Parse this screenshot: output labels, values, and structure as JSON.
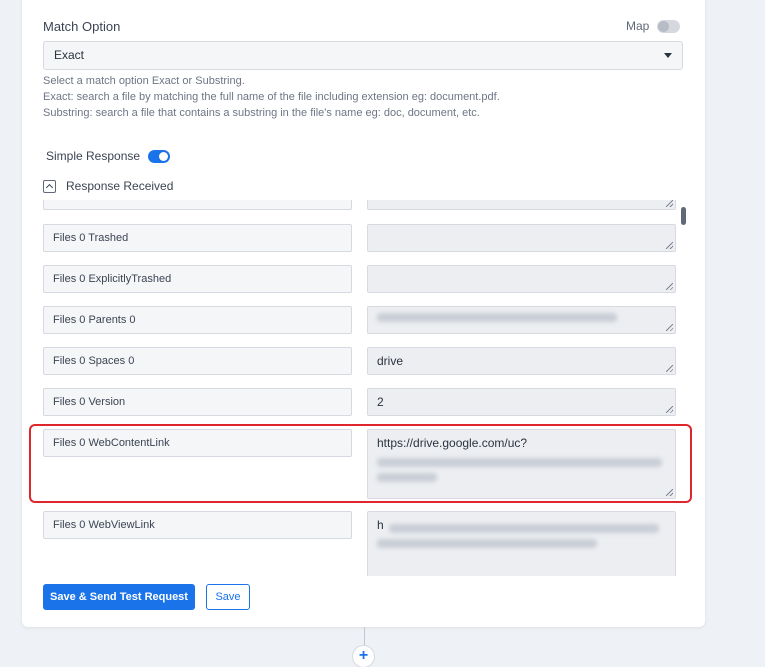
{
  "match": {
    "label": "Match Option",
    "map_label": "Map",
    "selected": "Exact",
    "help_lines": [
      "Select a match option Exact or Substring.",
      "Exact: search a file by matching the full name of the file including extension eg: document.pdf.",
      "Substring: search a file that contains a substring in the file's name eg: doc, document, etc."
    ]
  },
  "simple_response": {
    "label": "Simple Response",
    "enabled": true
  },
  "response_received": {
    "label": "Response Received"
  },
  "rows": [
    {
      "key": "",
      "value": ""
    },
    {
      "key": "Files 0 Trashed",
      "value": ""
    },
    {
      "key": "Files 0 ExplicitlyTrashed",
      "value": ""
    },
    {
      "key": "Files 0 Parents 0",
      "value": ""
    },
    {
      "key": "Files 0 Spaces 0",
      "value": "drive"
    },
    {
      "key": "Files 0 Version",
      "value": "2"
    },
    {
      "key": "Files 0 WebContentLink",
      "value": "https://drive.google.com/uc?"
    },
    {
      "key": "Files 0 WebViewLink",
      "value": "h"
    }
  ],
  "actions": {
    "send_test_label": "Save & Send Test Request",
    "save_label": "Save",
    "add_step_label": "+"
  },
  "colors": {
    "primary": "#1a73e8",
    "highlight": "#e0262d"
  }
}
